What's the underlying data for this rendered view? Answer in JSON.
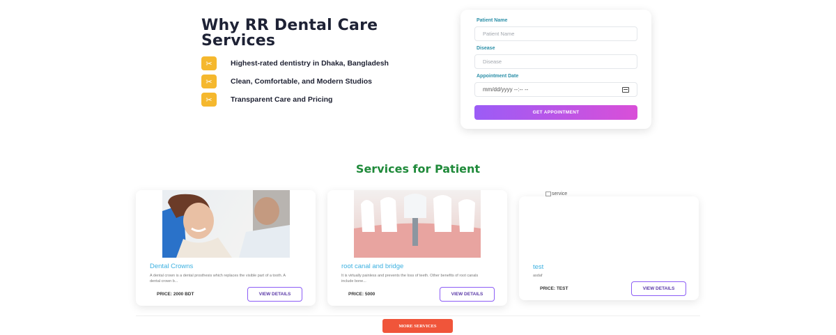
{
  "why": {
    "title": "Why RR Dental Care Services",
    "features": [
      {
        "icon": "scissors-icon",
        "glyph": "✂",
        "label": "Highest-rated dentistry in Dhaka, Bangladesh"
      },
      {
        "icon": "scissors-icon",
        "glyph": "✂",
        "label": "Clean, Comfortable, and Modern Studios"
      },
      {
        "icon": "scissors-icon",
        "glyph": "✂",
        "label": "Transparent Care and Pricing"
      }
    ]
  },
  "form": {
    "patient_label": "Patient Name",
    "patient_placeholder": "Patient Name",
    "disease_label": "Disease",
    "disease_placeholder": "Disease",
    "date_label": "Appointment Date",
    "date_placeholder": "mm/dd/yyyy --:-- --",
    "submit_label": "GET APPOINTMENT"
  },
  "services": {
    "title": "Services for Patient",
    "items": [
      {
        "name": "Dental Crowns",
        "description": "A dental crown is a dental prosthesis which replaces the visible part of a tooth. A dental crown b...",
        "price": "PRICE: 2000 BDT",
        "button": "VIEW DETAILS"
      },
      {
        "name": "root canal and bridge",
        "description": "It is virtually painless and prevents the loss of teeth. Other benefits of root canals include bone...",
        "price": "PRICE: 5000",
        "button": "VIEW DETAILS"
      },
      {
        "name": "test",
        "description": "asdaf",
        "price": "PRICE: TEST",
        "button": "VIEW DETAILS",
        "image_alt": "service"
      }
    ],
    "more_label": "MORE SERVICES"
  },
  "colors": {
    "accent_yellow": "#f5b82e",
    "title_green": "#1f8a3a",
    "card_title_blue": "#3bb0e0",
    "gradient_start": "#9b5cf6",
    "gradient_end": "#d94fd8",
    "more_button": "#f0553a"
  }
}
